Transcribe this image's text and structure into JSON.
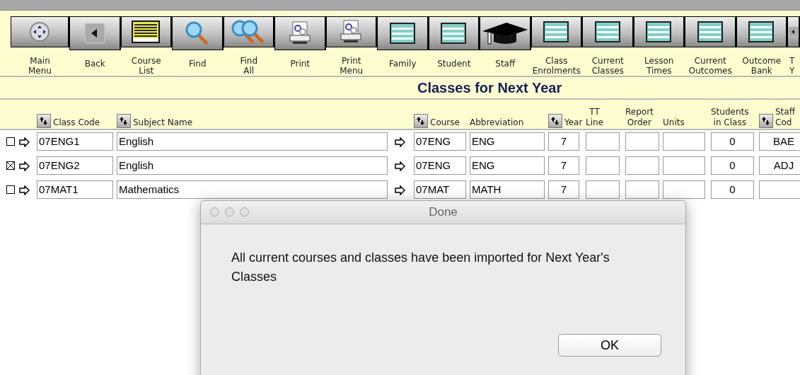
{
  "toolbar": [
    {
      "kind": "menu",
      "label": [
        "Main",
        "Menu"
      ]
    },
    {
      "kind": "back",
      "label": [
        "Back"
      ]
    },
    {
      "kind": "list",
      "label": [
        "Course",
        "List"
      ]
    },
    {
      "kind": "find",
      "label": [
        "Find"
      ]
    },
    {
      "kind": "find-all",
      "label": [
        "Find",
        "All"
      ]
    },
    {
      "kind": "print",
      "label": [
        "Print"
      ]
    },
    {
      "kind": "print",
      "label": [
        "Print",
        "Menu"
      ]
    },
    {
      "kind": "form",
      "label": [
        "Family"
      ]
    },
    {
      "kind": "form",
      "label": [
        "Student"
      ]
    },
    {
      "kind": "cap",
      "label": [
        "Staff"
      ]
    },
    {
      "kind": "form",
      "label": [
        "Class",
        "Enrolments"
      ]
    },
    {
      "kind": "form",
      "label": [
        "Current",
        "Classes"
      ]
    },
    {
      "kind": "form",
      "label": [
        "Lesson",
        "Times"
      ]
    },
    {
      "kind": "form",
      "label": [
        "Current",
        "Outcomes"
      ]
    },
    {
      "kind": "form",
      "label": [
        "Outcome",
        "Bank"
      ]
    },
    {
      "kind": "back",
      "label": [
        "T",
        "Y"
      ]
    }
  ],
  "title": "Classes for Next Year",
  "columns": [
    {
      "label": [
        "Class Code"
      ],
      "sort": true
    },
    {
      "label": [
        "Subject Name"
      ],
      "sort": true
    },
    {
      "label": [
        "Course"
      ],
      "sort": true
    },
    {
      "label": [
        "Abbreviation"
      ],
      "sort": false
    },
    {
      "label": [
        "Year"
      ],
      "sort": true
    },
    {
      "label": [
        "TT",
        "Line"
      ],
      "sort": false
    },
    {
      "label": [
        "Report",
        "Order"
      ],
      "sort": false
    },
    {
      "label": [
        "Units"
      ],
      "sort": false
    },
    {
      "label": [
        "Students",
        "in Class"
      ],
      "sort": false
    },
    {
      "label": [
        "Staff",
        "Cod"
      ],
      "sort": true
    }
  ],
  "rows": [
    {
      "checked": false,
      "class_code": "07ENG1",
      "subject_name": "English",
      "course": "07ENG",
      "abbreviation": "ENG",
      "year": "7",
      "students": "0",
      "staff_code": "BAE"
    },
    {
      "checked": true,
      "class_code": "07ENG2",
      "subject_name": "English",
      "course": "07ENG",
      "abbreviation": "ENG",
      "year": "7",
      "students": "0",
      "staff_code": "ADJ"
    },
    {
      "checked": false,
      "class_code": "07MAT1",
      "subject_name": "Mathematics",
      "course": "07MAT",
      "abbreviation": "MATH",
      "year": "7",
      "students": "0",
      "staff_code": ""
    }
  ],
  "dialog": {
    "title": "Done",
    "message": "All current courses and classes have been imported for Next Year's Classes",
    "buttons": [
      "OK"
    ]
  }
}
